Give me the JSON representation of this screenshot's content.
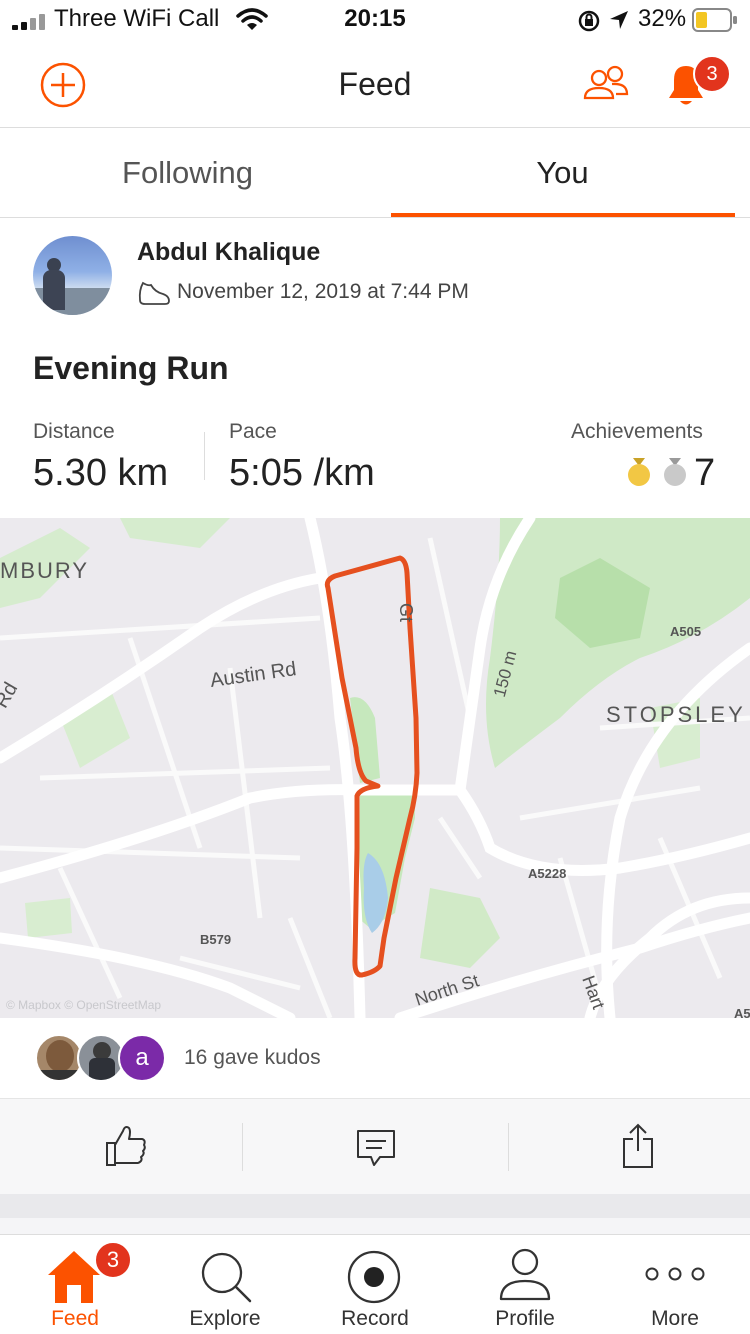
{
  "status_bar": {
    "carrier": "Three WiFi Call",
    "time": "20:15",
    "battery": "32%"
  },
  "header": {
    "title": "Feed",
    "notification_count": "3"
  },
  "tabs": [
    {
      "label": "Following"
    },
    {
      "label": "You"
    }
  ],
  "activity": {
    "athlete": "Abdul Khalique",
    "date": "November 12, 2019 at 7:44 PM",
    "title": "Evening Run",
    "stats": {
      "distance_label": "Distance",
      "distance_value": "5.30 km",
      "pace_label": "Pace",
      "pace_value": "5:05 /km",
      "achievements_label": "Achievements",
      "achievements_value": "7"
    }
  },
  "map": {
    "labels": {
      "bury": "MBURY",
      "austin": "Austin Rd",
      "a505": "A505",
      "stopsley": "STOPSLEY",
      "150m": "150 m",
      "a5228": "A5228",
      "b579": "B579",
      "north": "North St",
      "hart": "Hart",
      "a5": "A5",
      "gt": "Gt",
      "rd": "Rd",
      "copyright": "© Mapbox © OpenStreetMap"
    }
  },
  "kudos": {
    "text": "16 gave kudos",
    "initial": "a"
  },
  "nav": {
    "badge": "3",
    "items": [
      {
        "label": "Feed"
      },
      {
        "label": "Explore"
      },
      {
        "label": "Record"
      },
      {
        "label": "Profile"
      },
      {
        "label": "More"
      }
    ]
  },
  "colors": {
    "accent": "#fc5200",
    "badge": "#e2341d",
    "route": "#e5501f",
    "park": "#c6e8bd"
  }
}
